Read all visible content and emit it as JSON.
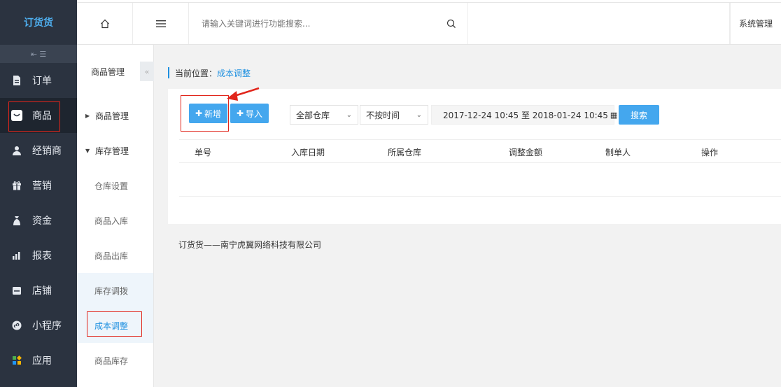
{
  "app": {
    "logo": "订货货"
  },
  "sidebar": {
    "items": [
      {
        "label": "订单",
        "icon": "document-icon"
      },
      {
        "label": "商品",
        "icon": "product-icon",
        "active": true
      },
      {
        "label": "经销商",
        "icon": "user-icon"
      },
      {
        "label": "营销",
        "icon": "gift-icon"
      },
      {
        "label": "资金",
        "icon": "money-bag-icon"
      },
      {
        "label": "报表",
        "icon": "bar-chart-icon"
      },
      {
        "label": "店铺",
        "icon": "store-icon"
      },
      {
        "label": "小程序",
        "icon": "mini-program-icon"
      },
      {
        "label": "应用",
        "icon": "apps-icon"
      }
    ]
  },
  "topbar": {
    "search_placeholder": "请输入关键词进行功能搜索...",
    "system_label": "系统管理"
  },
  "subside": {
    "title": "商品管理",
    "groups": [
      {
        "label": "商品管理",
        "expanded": false
      },
      {
        "label": "库存管理",
        "expanded": true
      }
    ],
    "children": [
      "仓库设置",
      "商品入库",
      "商品出库",
      "库存调拨",
      "成本调整",
      "商品库存"
    ]
  },
  "breadcrumb": {
    "prefix": "当前位置：",
    "current": "成本调整"
  },
  "toolbar": {
    "add_label": "新增",
    "import_label": "导入",
    "warehouse_select": "全部仓库",
    "time_select": "不按时间",
    "date_range": "2017-12-24 10:45 至 2018-01-24 10:45",
    "search_label": "搜索"
  },
  "table": {
    "columns": [
      "单号",
      "入库日期",
      "所属仓库",
      "调整金额",
      "制单人",
      "操作"
    ]
  },
  "footer": {
    "text": "订货货——南宁虎翼网络科技有限公司"
  },
  "colors": {
    "accent": "#44a7ee",
    "sidebar_bg": "#2b3340",
    "highlight_border": "#e1251b"
  }
}
